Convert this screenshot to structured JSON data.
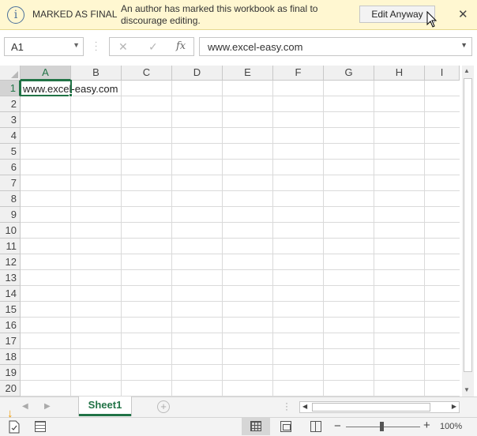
{
  "message_bar": {
    "title": "MARKED AS FINAL",
    "message": "An author has marked this workbook as final to discourage editing.",
    "button": "Edit Anyway",
    "info_glyph": "i",
    "close_glyph": "✕"
  },
  "formula_bar": {
    "name_box": "A1",
    "cancel_glyph": "✕",
    "enter_glyph": "✓",
    "fx_glyph": "fx",
    "value": "www.excel-easy.com"
  },
  "grid": {
    "columns": [
      "A",
      "B",
      "C",
      "D",
      "E",
      "F",
      "G",
      "H",
      "I"
    ],
    "rows": [
      "1",
      "2",
      "3",
      "4",
      "5",
      "6",
      "7",
      "8",
      "9",
      "10",
      "11",
      "12",
      "13",
      "14",
      "15",
      "16",
      "17",
      "18",
      "19",
      "20"
    ],
    "active_cell": "A1",
    "cell_a1": "www.excel-easy.com"
  },
  "sheets": {
    "tabs": [
      "Sheet1"
    ],
    "active": "Sheet1",
    "add_glyph": "+"
  },
  "status_bar": {
    "zoom": "100%",
    "view": "normal"
  },
  "colors": {
    "excel_green": "#217346",
    "message_bar_bg": "#fff7d1",
    "accent_arrow": "#f29b00"
  },
  "icons": [
    "info-icon",
    "close-icon",
    "cursor-icon",
    "dropdown-icon",
    "cancel-icon",
    "enter-icon",
    "function-icon",
    "add-sheet-icon",
    "macro-record-icon",
    "page-icon",
    "normal-view-icon",
    "page-layout-view-icon",
    "page-break-view-icon"
  ]
}
